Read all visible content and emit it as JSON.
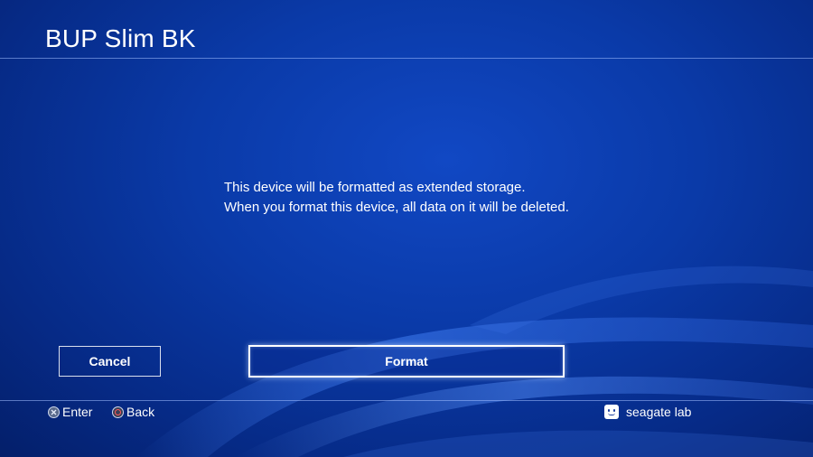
{
  "header": {
    "title": "BUP Slim BK"
  },
  "message": {
    "line1": "This device will be formatted as extended storage.",
    "line2": "When you format this device, all data on it will be deleted."
  },
  "buttons": {
    "cancel_label": "Cancel",
    "format_label": "Format",
    "focused": "Format"
  },
  "footer": {
    "enter_hint": "Enter",
    "back_hint": "Back",
    "enter_icon": "cross-button-icon",
    "back_icon": "circle-button-icon",
    "user_name": "seagate lab",
    "user_icon": "avatar-icon"
  },
  "colors": {
    "background": "#0a3aa8",
    "text": "#ffffff",
    "back_glyph": "#ff5a5a"
  }
}
